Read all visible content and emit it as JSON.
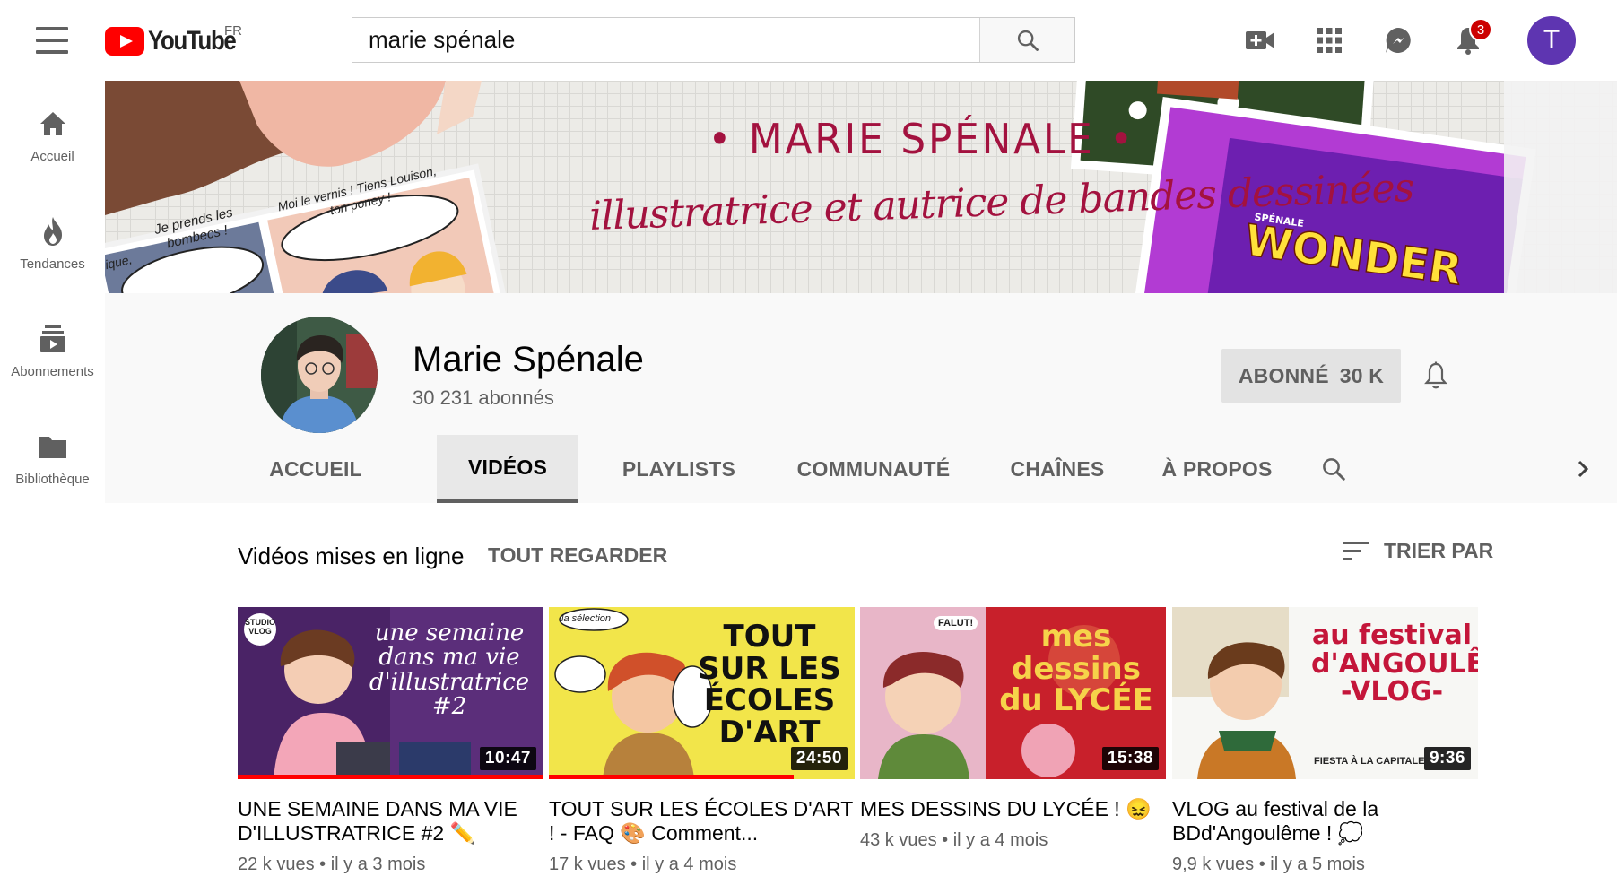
{
  "header": {
    "logo_text": "YouTube",
    "region": "FR",
    "search_value": "marie spénale",
    "notification_count": "3",
    "avatar_letter": "T",
    "icons": [
      "menu-icon",
      "search-icon",
      "video-camera-plus-icon",
      "apps-grid-icon",
      "messages-icon",
      "bell-icon"
    ]
  },
  "sidebar": {
    "items": [
      {
        "label": "Accueil",
        "icon": "home-icon"
      },
      {
        "label": "Tendances",
        "icon": "flame-icon"
      },
      {
        "label": "Abonnements",
        "icon": "subscriptions-icon"
      },
      {
        "label": "Bibliothèque",
        "icon": "folder-icon"
      }
    ]
  },
  "banner": {
    "title": "• MARIE SPÉNALE •",
    "subtitle": "illustratrice et autrice de bandes dessinées",
    "bubble_1": "Je prends les bombecs !",
    "bubble_2": "Moi le vernis ! Tiens Louison, ton poney !",
    "bubble_edge": "ique,",
    "book_brand": "SPÉNALE",
    "book_title": "WONDER"
  },
  "channel": {
    "name": "Marie Spénale",
    "subscribers": "30 231 abonnés",
    "subscribed_label": "ABONNÉ",
    "subscribed_count": "30 K",
    "tabs": [
      {
        "label": "ACCUEIL",
        "active": false
      },
      {
        "label": "VIDÉOS",
        "active": true
      },
      {
        "label": "PLAYLISTS",
        "active": false
      },
      {
        "label": "COMMUNAUTÉ",
        "active": false
      },
      {
        "label": "CHAÎNES",
        "active": false
      },
      {
        "label": "À PROPOS",
        "active": false
      }
    ]
  },
  "section": {
    "title": "Vidéos mises en ligne",
    "play_all": "TOUT REGARDER",
    "sort_label": "TRIER PAR"
  },
  "videos": [
    {
      "title": "UNE SEMAINE DANS MA VIE D'ILLUSTRATRICE #2 ✏️",
      "duration": "10:47",
      "views": "22 k vues",
      "age": "il y a 3 mois",
      "thumb_text": "une semaine dans ma vie d'illustratrice #2",
      "thumb_tag": "STUDIO VLOG",
      "watched_fraction": 1.0,
      "colors": {
        "bg": "#5b2e7a",
        "accent": "#f3b3c6"
      }
    },
    {
      "title": "TOUT SUR LES ÉCOLES D'ART ! - FAQ 🎨 Comment...",
      "duration": "24:50",
      "views": "17 k vues",
      "age": "il y a 4 mois",
      "thumb_text": "TOUT SUR LES ÉCOLES D'ART",
      "thumb_tag": "la sélection",
      "watched_fraction": 0.8,
      "colors": {
        "bg": "#f2e54a",
        "accent": "#d63a1f"
      }
    },
    {
      "title": "MES DESSINS DU LYCÉE ! 😖",
      "duration": "15:38",
      "views": "43 k vues",
      "age": "il y a 4 mois",
      "thumb_text": "mes dessins du LYCÉE",
      "thumb_tag": "FALUT!",
      "watched_fraction": 0.0,
      "colors": {
        "bg": "#c8202b",
        "accent": "#f6d34a"
      }
    },
    {
      "title": "VLOG au festival de la BDd'Angoulême ! 💭",
      "duration": "9:36",
      "views": "9,9 k vues",
      "age": "il y a 5 mois",
      "thumb_text": "au festival d'ANGOULÊME -VLOG-",
      "thumb_tag": "FIESTA À LA CAPITALE",
      "watched_fraction": 0.0,
      "colors": {
        "bg": "#f7f7f4",
        "accent": "#c4163a"
      }
    }
  ]
}
